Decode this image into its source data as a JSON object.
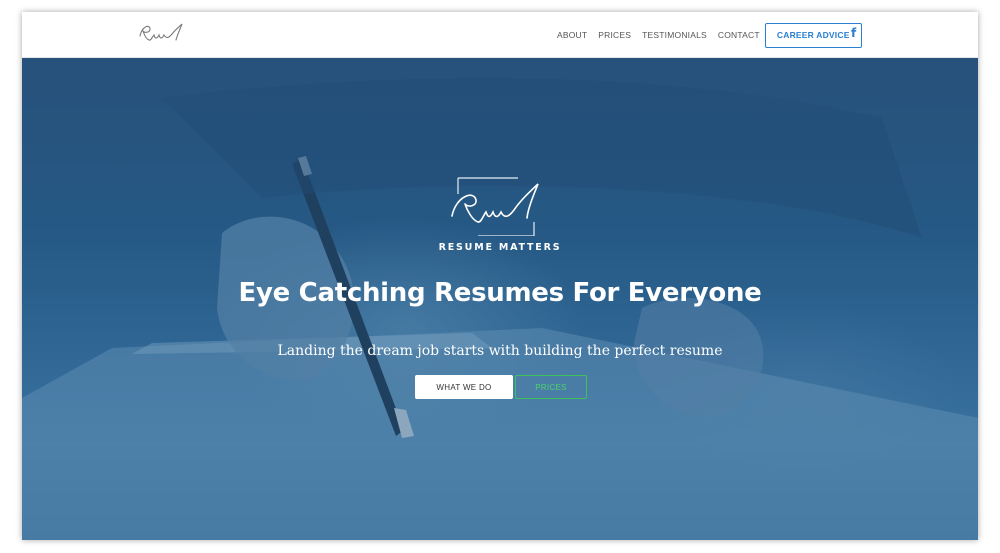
{
  "nav": {
    "links": [
      {
        "label": "ABOUT"
      },
      {
        "label": "PRICES"
      },
      {
        "label": "TESTIMONIALS"
      },
      {
        "label": "CONTACT"
      }
    ],
    "cta_label": "CAREER ADVICE",
    "social_icon": "facebook-icon",
    "social_glyph": "f"
  },
  "hero": {
    "brand": "RESUME MATTERS",
    "title": "Eye Catching Resumes For Everyone",
    "subtitle": "Landing the dream job starts with building the perfect resume",
    "primary_button": "WHAT WE DO",
    "secondary_button": "PRICES"
  },
  "colors": {
    "accent_blue": "#2a7fd0",
    "hero_overlay": "#1e5587",
    "secondary_green": "#3fc15a"
  }
}
